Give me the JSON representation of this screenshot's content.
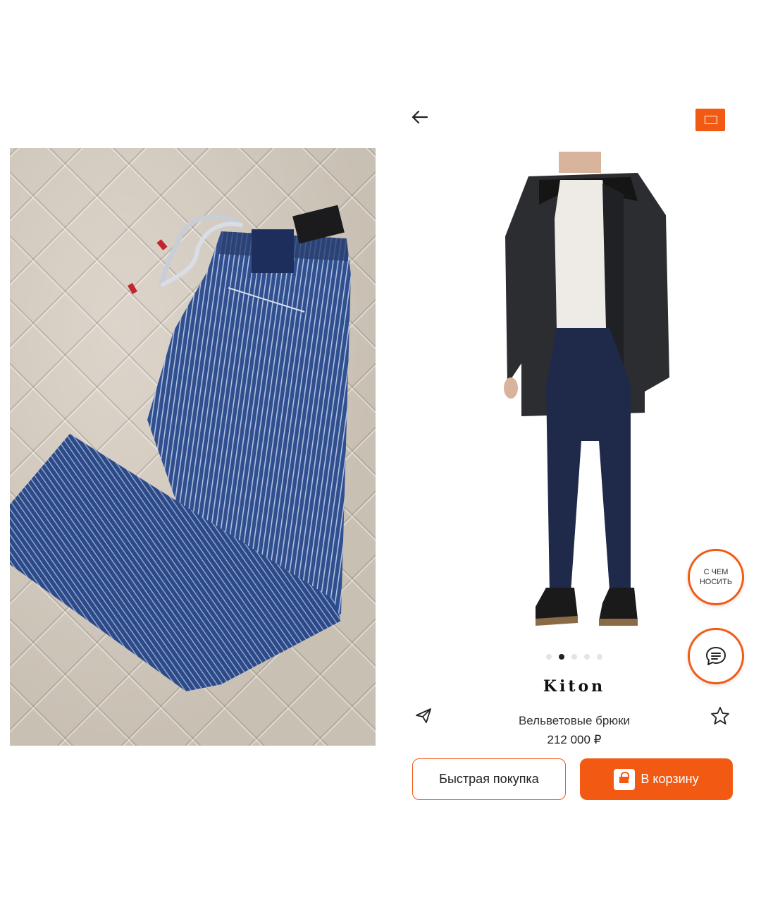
{
  "left_photo": {
    "alt": ""
  },
  "header": {
    "back_label": "",
    "cart_label": ""
  },
  "product": {
    "brand": "Kiton",
    "title": "Вельветовые брюки",
    "price": "212 000 ₽",
    "gallery": {
      "total": 5,
      "active_index": 1
    }
  },
  "floating": {
    "wear_with": "С ЧЕМ НОСИТЬ"
  },
  "actions": {
    "quick_buy": "Быстрая покупка",
    "add_to_cart": "В корзину"
  },
  "colors": {
    "accent": "#f25a14"
  }
}
